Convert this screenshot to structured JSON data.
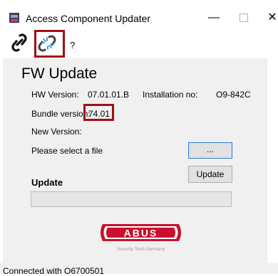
{
  "window": {
    "title": "Access Component Updater",
    "minimize_icon": "minimize-icon",
    "maximize_icon": "maximize-icon",
    "close_icon": "close-icon"
  },
  "toolbar": {
    "connect_icon": "link-icon",
    "disconnect_icon": "broken-link-icon",
    "help_label": "?"
  },
  "main": {
    "heading": "FW Update",
    "hw_version_label": "HW Version:",
    "hw_version_value": "07.01.01.B",
    "installation_label": "Installation no:",
    "installation_value": "O9-842C",
    "bundle_version_label": "Bundle version:",
    "bundle_version_value": "74.01",
    "new_version_label": "New Version:",
    "select_file_label": "Please select a file",
    "browse_button_label": "...",
    "update_button_label": "Update",
    "update_section_label": "Update",
    "progress": 0
  },
  "logo": {
    "brand": "ABUS",
    "tagline": "Security Tech Germany"
  },
  "status": {
    "text": "Connected with O6700501"
  },
  "colors": {
    "highlight": "#a30d14",
    "abus_red": "#c8102e",
    "form_background": "#f0f0f0",
    "focus_border": "#2b79d7"
  }
}
